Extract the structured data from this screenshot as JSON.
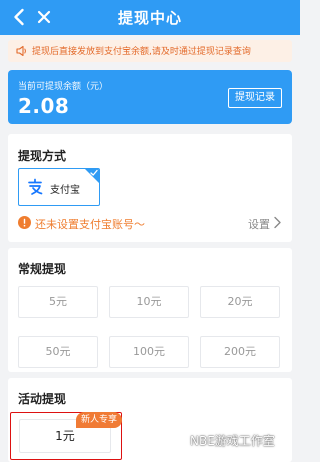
{
  "header": {
    "title": "提现中心",
    "back_icon": "chevron-left-icon",
    "close_icon": "close-icon"
  },
  "notice": {
    "icon": "speaker-icon",
    "text": "提现后直接发放到支付宝余额,请及时通过提现记录查询"
  },
  "balance": {
    "label": "当前可提现余额（元）",
    "amount": "2.08",
    "record_button": "提现记录"
  },
  "method": {
    "title": "提现方式",
    "option_name": "支付宝",
    "option_icon": "alipay-icon",
    "warning_text": "还未设置支付宝账号～",
    "setting_label": "设置"
  },
  "regular": {
    "title": "常规提现",
    "amounts": [
      "5元",
      "10元",
      "20元",
      "50元",
      "100元",
      "200元"
    ]
  },
  "activity": {
    "title": "活动提现",
    "amount": "1元",
    "badge": "新人专享"
  },
  "watermark": {
    "text": "NBE游戏工作室"
  },
  "colors": {
    "primary": "#2f9bf4",
    "notice_bg": "#fdf0e6",
    "warning": "#ef7d2f",
    "badge": "#f07b35",
    "highlight": "#dd1111"
  }
}
